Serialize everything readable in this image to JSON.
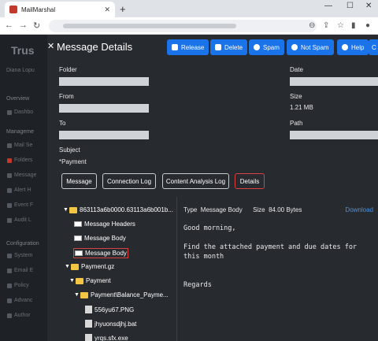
{
  "browser": {
    "tab_title": "MailMarshal",
    "new_tab": "+"
  },
  "bg_app": {
    "logo": "Trus",
    "user": "Diana Lopu",
    "sections": [
      "Overview",
      "Manageme",
      "Configuration"
    ],
    "items_overview": [
      "Dashbo"
    ],
    "items_manage": [
      "Mail Se",
      "Folders",
      "Message",
      "Alert H",
      "Event F",
      "Audit L"
    ],
    "items_config": [
      "System",
      "Email E",
      "Policy",
      "Advanc",
      "Author"
    ]
  },
  "modal": {
    "title": "Message Details",
    "buttons": {
      "release": "Release",
      "delete": "Delete",
      "spam": "Spam",
      "not_spam": "Not Spam",
      "help": "Help",
      "extra": "C"
    },
    "fields": {
      "folder": "Folder",
      "date": "Date",
      "from": "From",
      "size": "Size",
      "size_value": "1.21 MB",
      "to": "To",
      "path": "Path",
      "subject": "Subject",
      "subject_value": "*Payment"
    },
    "tabs": [
      "Message",
      "Connection Log",
      "Content Analysis Log",
      "Details"
    ],
    "active_tab": "Details"
  },
  "tree": {
    "root": "863113a6b0000.63113a6b001b...",
    "items": [
      "Message Headers",
      "Message Body",
      "Message Body",
      "Payment.gz",
      "Payment",
      "Payment\\Balance_Payme...",
      "556yu67.PNG",
      "jhyuonsdjhj.bat",
      "yrqs.sfx.exe"
    ]
  },
  "pane": {
    "type_label": "Type",
    "type_value": "Message Body",
    "size_label": "Size",
    "size_value": "84.00 Bytes",
    "download": "Download",
    "body": "Good morning,\n\nFind the attached payment and due dates for this month\n\n\nRegards"
  }
}
